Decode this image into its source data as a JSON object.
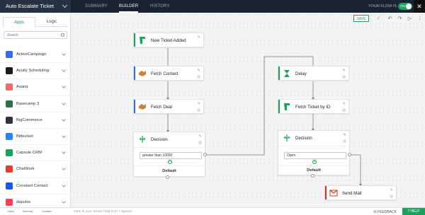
{
  "topbar": {
    "flow_name": "Auto Escalate Ticket",
    "tabs": [
      {
        "label": "SUMMARY"
      },
      {
        "label": "BUILDER"
      },
      {
        "label": "HISTORY"
      }
    ],
    "live_label": "YOUR FLOW IS",
    "toggle_label": "ON",
    "close_glyph": "✕"
  },
  "sidebar": {
    "tabs": [
      {
        "label": "Apps"
      },
      {
        "label": "Logic"
      }
    ],
    "search_placeholder": "Search",
    "apps": [
      {
        "name": "ActiveCampaign",
        "color": "#356ae6"
      },
      {
        "name": "Acuity Scheduling",
        "color": "#1b1b1b"
      },
      {
        "name": "Asana",
        "color": "#f06a6a"
      },
      {
        "name": "Basecamp 3",
        "color": "#2f6f4e"
      },
      {
        "name": "BigCommerce",
        "color": "#34313f"
      },
      {
        "name": "Bitbucket",
        "color": "#2684ff"
      },
      {
        "name": "Capsule CRM",
        "color": "#19a35b"
      },
      {
        "name": "ChatWork",
        "color": "#e53935"
      },
      {
        "name": "Constant Contact",
        "color": "#1856ed"
      },
      {
        "name": "dapulse",
        "color": "#ff3d57"
      }
    ]
  },
  "bottombar": {
    "items": [
      {
        "label": "Users"
      },
      {
        "label": "Overview"
      },
      {
        "label": "Contacts"
      }
    ],
    "chat_placeholder": "Here is your Smart Chat (Ctrl + Space)",
    "feedback": "FEEDBACK",
    "help": "HELP"
  },
  "canvas": {
    "save_label": "SAVE",
    "nodes": {
      "new_ticket": {
        "title": "New Ticket Added"
      },
      "fetch_contact": {
        "title": "Fetch Contact"
      },
      "fetch_deal": {
        "title": "Fetch Deal"
      },
      "decision_left": {
        "title": "Decision",
        "condition": "greater than 10000",
        "default": "Default"
      },
      "delay": {
        "title": "Delay"
      },
      "fetch_ticket": {
        "title": "Fetch Ticket by ID"
      },
      "decision_right": {
        "title": "Decision",
        "condition": "Open",
        "default": "Default"
      },
      "send_mail": {
        "title": "Send Mail"
      }
    }
  },
  "colors": {
    "brand_green": "#19a35b",
    "topbar": "#1a2330"
  }
}
